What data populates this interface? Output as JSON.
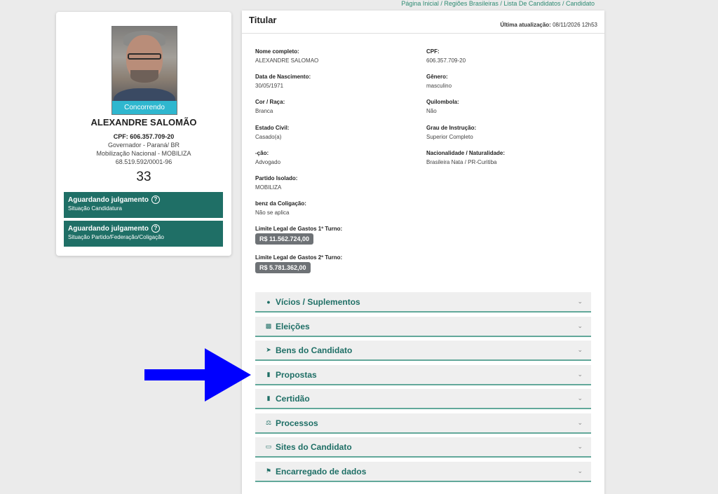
{
  "breadcrumb": "Página Inicial / Regiões Brasileiras / Lista De Candidatos / Candidato",
  "candidate": {
    "photo_status": "Concorrendo",
    "name": "ALEXANDRE SALOMÃO",
    "cpf": "CPF: 606.357.709-20",
    "office": "Governador - Paraná/ BR",
    "party": "Mobilização Nacional - MOBILIZA",
    "cnpj": "68.519.592/0001-96",
    "number": "33"
  },
  "status_boxes": [
    {
      "title": "Aguardando julgamento",
      "subtitle": "Situação Candidatura",
      "icon": "question-circle-icon"
    },
    {
      "title": "Aguardando julgamento",
      "subtitle": "Situação Partido/Federação/Coligação",
      "icon": "question-circle-icon"
    }
  ],
  "main": {
    "title": "Titular",
    "last_update_label": "Última atualização:",
    "last_update_value": "08/11/2026 12h53",
    "fields_left": [
      {
        "label": "Nome completo:",
        "value": "ALEXANDRE SALOMAO"
      },
      {
        "label": "Data de Nascimento:",
        "value": "30/05/1971"
      },
      {
        "label": "Cor / Raça:",
        "value": "Branca"
      },
      {
        "label": "Estado Civil:",
        "value": "Casado(a)"
      },
      {
        "label": "-ção:",
        "value": "Advogado"
      },
      {
        "label": "Partido Isolado:",
        "value": "MOBILIZA"
      },
      {
        "label": "benz da Coligação:",
        "value": "Não se aplica"
      }
    ],
    "fields_right": [
      {
        "label": "CPF:",
        "value": "606.357.709-20"
      },
      {
        "label": "Gênero:",
        "value": "masculino"
      },
      {
        "label": "Quilombola:",
        "value": "Não"
      },
      {
        "label": "Grau de Instrução:",
        "value": "Superior Completo"
      },
      {
        "label": "Nacionalidade / Naturalidade:",
        "value": "Brasileira Nata / PR-Curitiba"
      }
    ],
    "limits": [
      {
        "label": "Limite Legal de Gastos 1º Turno:",
        "value": "R$ 11.562.724,00"
      },
      {
        "label": "Limite Legal de Gastos 2º Turno:",
        "value": "R$ 5.781.362,00"
      }
    ]
  },
  "accordion": [
    {
      "label": "Vícios / Suplementos",
      "icon": "user-icon"
    },
    {
      "label": "Eleições",
      "icon": "sitemap-icon"
    },
    {
      "label": "Bens do Candidato",
      "icon": "rocket-icon"
    },
    {
      "label": "Propostas",
      "icon": "file-icon"
    },
    {
      "label": "Certidão",
      "icon": "file-icon"
    },
    {
      "label": "Processos",
      "icon": "scale-icon"
    },
    {
      "label": "Sites do Candidato",
      "icon": "laptop-icon"
    },
    {
      "label": "Encarregado de dados",
      "icon": "user-shield-icon"
    }
  ],
  "colors": {
    "accent": "#1f6f66",
    "status_cyan": "#2fb7cf",
    "arrow": "#0000ff"
  }
}
